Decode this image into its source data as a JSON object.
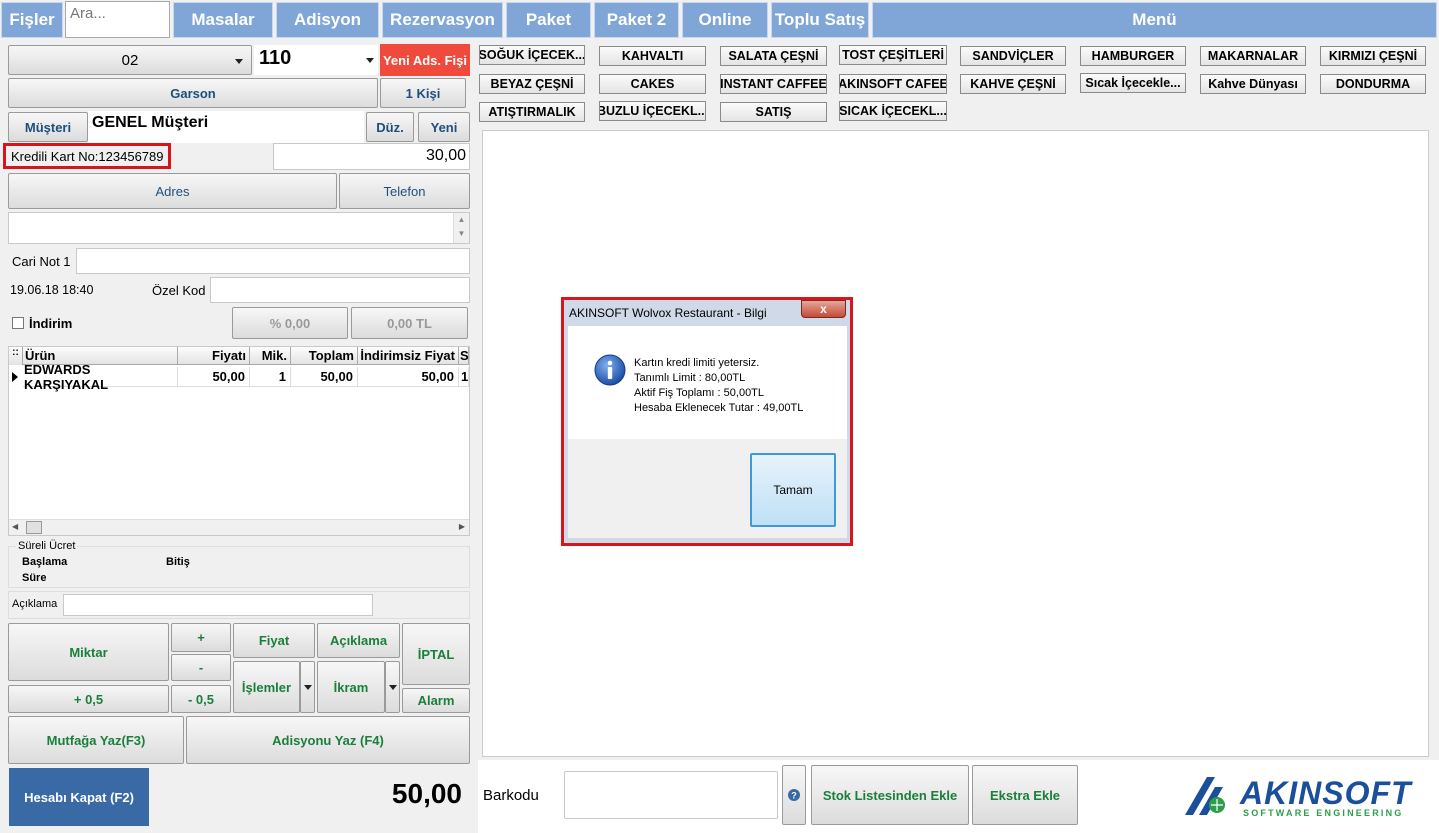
{
  "top_tabs": {
    "fisler": "Fişler",
    "search_placeholder": "Ara...",
    "masalar": "Masalar",
    "adisyon": "Adisyon",
    "rezervasyon": "Rezervasyon",
    "paket": "Paket",
    "paket2": "Paket 2",
    "online": "Online",
    "toplu_satis": "Toplu Satış",
    "menu": "Menü"
  },
  "order": {
    "table_select": "02",
    "table_no": "110",
    "new_receipt": "Yeni Ads. Fişi",
    "waiter": "Garson",
    "persons": "1 Kişi",
    "customer_btn": "Müşteri",
    "customer_name": "GENEL Müşteri",
    "edit_btn": "Düz.",
    "new_btn": "Yeni",
    "credit_card": "Kredili Kart No:123456789",
    "balance": "30,00",
    "address_btn": "Adres",
    "phone_btn": "Telefon",
    "cari_note_label": "Cari Not 1",
    "datetime": "19.06.18 18:40",
    "special_code_label": "Özel Kod",
    "discount_label": "İndirim",
    "discount_pct": "% 0,00",
    "discount_amt": "0,00 TL"
  },
  "grid": {
    "headers": [
      "Ürün",
      "Fiyatı",
      "Mik.",
      "Toplam",
      "İndirimsiz Fiyat",
      "S"
    ],
    "rows": [
      [
        "EDWARDS KARŞIYAKAL",
        "50,00",
        "1",
        "50,00",
        "50,00",
        "1"
      ]
    ]
  },
  "timed": {
    "title": "Süreli Ücret",
    "start": "Başlama",
    "end": "Bitiş",
    "duration": "Süre"
  },
  "note_label": "Açıklama",
  "actions": {
    "miktar": "Miktar",
    "plus": "+",
    "minus": "-",
    "plus_half": "+ 0,5",
    "minus_half": "- 0,5",
    "fiyat": "Fiyat",
    "aciklama": "Açıklama",
    "islemler": "İşlemler",
    "ikram": "İkram",
    "iptal": "İPTAL",
    "alarm": "Alarm",
    "kitchen": "Mutfağa Yaz(F3)",
    "print_bill": "Adisyonu Yaz (F4)",
    "close_bill": "Hesabı Kapat (F2)",
    "total": "50,00"
  },
  "categories": [
    "SOĞUK İÇECEK...",
    "KAHVALTI",
    "SALATA ÇEŞNİ",
    "TOST ÇEŞİTLERİ",
    "SANDVİÇLER",
    "HAMBURGER",
    "MAKARNALAR",
    "KIRMIZI ÇEŞNİ",
    "BEYAZ ÇEŞNİ",
    "CAKES",
    "INSTANT CAFFEE",
    "AKINSOFT CAFEE",
    "KAHVE ÇEŞNİ",
    "Sıcak İçecekle...",
    "Kahve Dünyası",
    "DONDURMA",
    "ATIŞTIRMALIK",
    "BUZLU İÇECEKL...",
    "SATIŞ",
    "SICAK İÇECEKL..."
  ],
  "bottom": {
    "barcode_label": "Barkodu",
    "stock_add": "Stok Listesinden Ekle",
    "extra_add": "Ekstra Ekle",
    "logo_text": "AKINSOFT",
    "logo_sub": "SOFTWARE ENGINEERING"
  },
  "dialog": {
    "title": "AKINSOFT Wolvox Restaurant - Bilgi",
    "close": "x",
    "line1": "Kartın kredi limiti yetersiz.",
    "line2": "Tanımlı Limit : 80,00TL",
    "line3": "Aktif Fiş Toplamı : 50,00TL",
    "line4": "Hesaba Eklenecek Tutar : 49,00TL",
    "ok": "Tamam"
  },
  "colors": {
    "tab_blue": "#7fa6d6",
    "new_receipt_red": "#f04a3c",
    "highlight_red": "#d8151d",
    "close_button_blue": "#3a6aa6",
    "action_green": "#1a7f3a",
    "logo_blue": "#1a4f9c"
  }
}
